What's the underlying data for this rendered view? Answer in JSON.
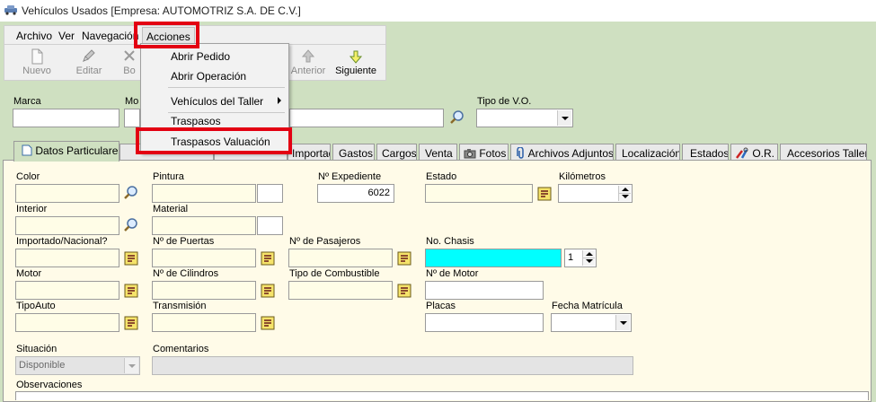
{
  "window": {
    "title": "Vehículos Usados [Empresa: AUTOMOTRIZ S.A. DE C.V.]"
  },
  "menubar": {
    "archivo": "Archivo",
    "ver": "Ver",
    "navegacion": "Navegación",
    "acciones": "Acciones"
  },
  "toolbar": {
    "nuevo": "Nuevo",
    "editar": "Editar",
    "borrar": "Bo",
    "anterior": "Anterior",
    "siguiente": "Siguiente"
  },
  "acciones_menu": {
    "items": [
      "Abrir Pedido",
      "Abrir Operación",
      "Vehículos del Taller",
      "Traspasos",
      "Traspasos Valuación"
    ]
  },
  "search": {
    "marca_label": "Marca",
    "modelo_label": "Mo",
    "tipo_vo_label": "Tipo de V.O."
  },
  "tabs": {
    "items": [
      "Datos Particulares",
      "",
      "",
      "Importado",
      "Gastos",
      "Cargos",
      "Venta",
      "Fotos",
      "Archivos Adjuntos",
      "Localización",
      "Estados",
      "O.R.",
      "Accesorios Taller"
    ]
  },
  "form": {
    "color": "Color",
    "pintura": "Pintura",
    "expediente": "Nº Expediente",
    "expediente_value": "6022",
    "estado": "Estado",
    "kilometros": "Kilómetros",
    "interior": "Interior",
    "material": "Material",
    "importado": "Importado/Nacional?",
    "puertas": "Nº de Puertas",
    "pasajeros": "Nº de Pasajeros",
    "chasis": "No. Chasis",
    "chasis_spin_value": "1",
    "motor": "Motor",
    "cilindros": "Nº de Cilindros",
    "combustible": "Tipo de Combustible",
    "num_motor": "Nº de Motor",
    "tipo_auto": "TipoAuto",
    "transmision": "Transmisión",
    "placas": "Placas",
    "fecha_matricula": "Fecha Matrícula",
    "situacion": "Situación",
    "situacion_value": "Disponible",
    "comentarios": "Comentarios",
    "observaciones": "Observaciones"
  },
  "colors": {
    "highlight": "#e30012",
    "cyan_field": "#00ffff",
    "background": "#cfe0c1"
  }
}
